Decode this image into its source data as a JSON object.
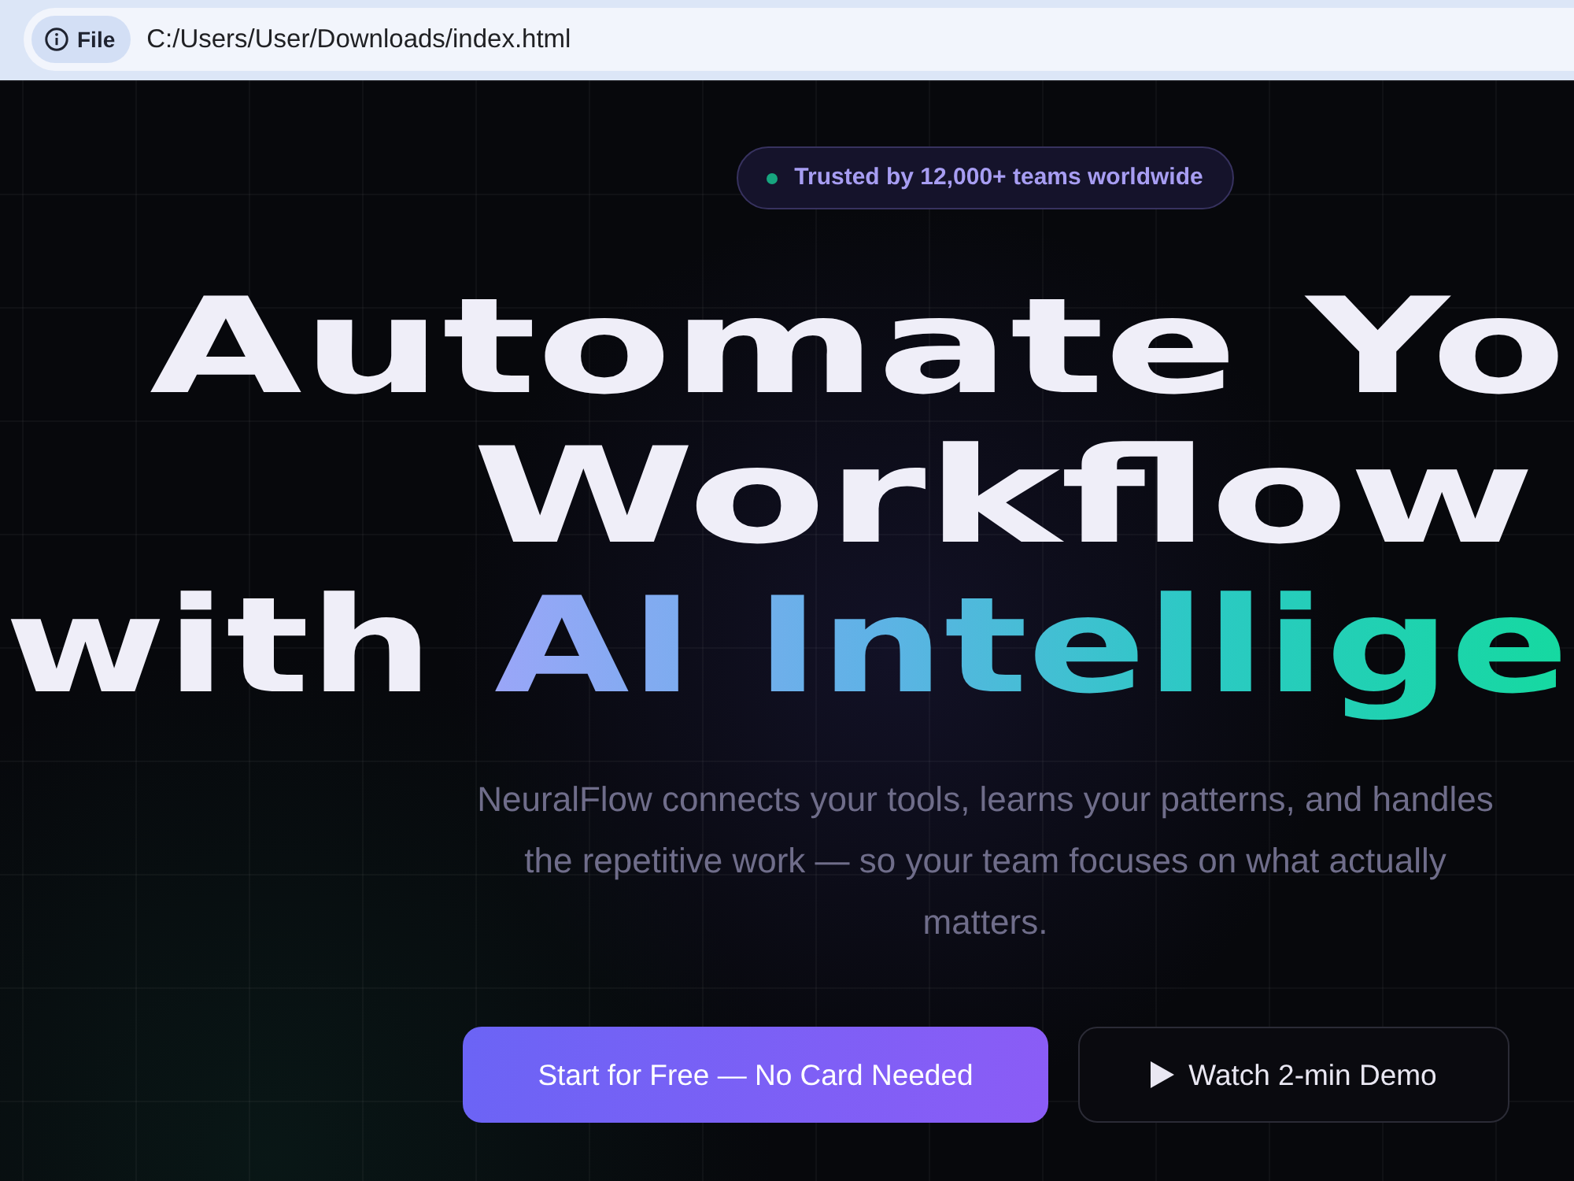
{
  "browser": {
    "site_chip": "File",
    "url": "C:/Users/User/Downloads/index.html"
  },
  "hero": {
    "badge": "Trusted by 12,000+ teams worldwide",
    "headline": [
      [
        {
          "text": "Automate Yo",
          "highlighted": false
        }
      ],
      [
        {
          "text": "Workflow",
          "highlighted": false
        }
      ],
      [
        {
          "text": "with",
          "highlighted": false
        },
        {
          "text": "AI Intellige",
          "highlighted": true
        }
      ]
    ],
    "subtitle": "NeuralFlow connects your tools, learns your patterns, and handles the repetitive work — so your team focuses on what actually matters.",
    "buttons": [
      {
        "label": "Start for Free — No Card Needed",
        "kind": "primary"
      },
      {
        "label": "Watch 2-min Demo",
        "kind": "video"
      }
    ]
  }
}
